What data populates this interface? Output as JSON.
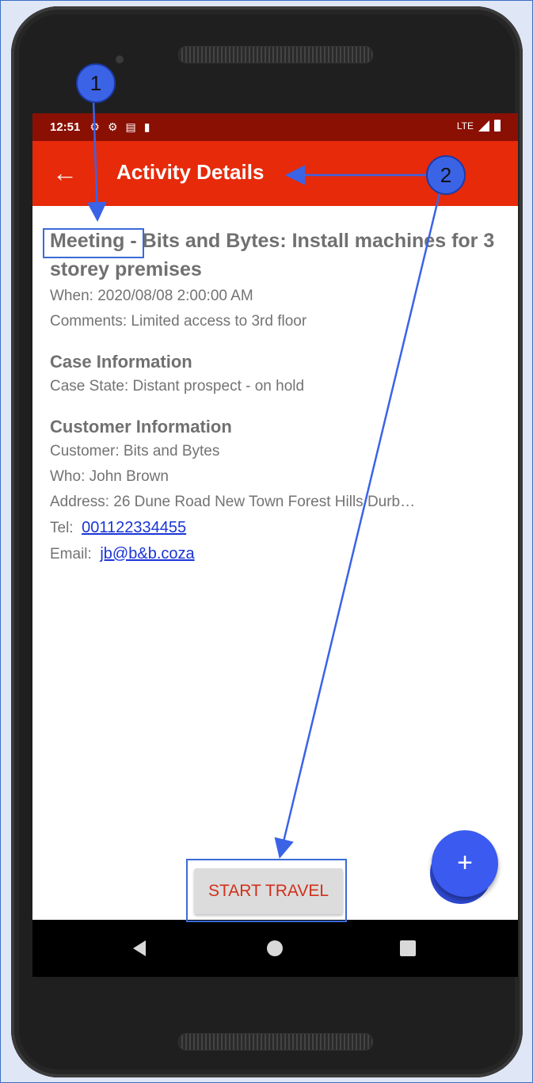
{
  "status_bar": {
    "time": "12:51",
    "network": "LTE"
  },
  "app_bar": {
    "back_icon": "←",
    "title": "Activity Details"
  },
  "activity": {
    "title_type": "Meeting",
    "title_rest": " - Bits and Bytes: Install machines for 3 storey premises",
    "when": "When: 2020/08/08 2:00:00 AM",
    "comments": "Comments: Limited access to 3rd floor"
  },
  "case_section": {
    "heading": "Case Information",
    "state": "Case State: Distant prospect - on hold"
  },
  "customer_section": {
    "heading": "Customer Information",
    "customer": "Customer: Bits and Bytes",
    "who": "Who: John  Brown",
    "address": "Address: 26 Dune Road New Town Forest Hills Durb…",
    "tel_label": "Tel:",
    "tel": "001122334455",
    "email_label": "Email:",
    "email": "jb@b&b.coza"
  },
  "start_travel_label": "START TRAVEL",
  "fab_label": "+",
  "callouts": {
    "one": "1",
    "two": "2"
  },
  "colors": {
    "app_bar": "#e62a0a",
    "status_bar": "#8a1004",
    "fab": "#3a5af0",
    "annotation": "#3b63e6"
  }
}
